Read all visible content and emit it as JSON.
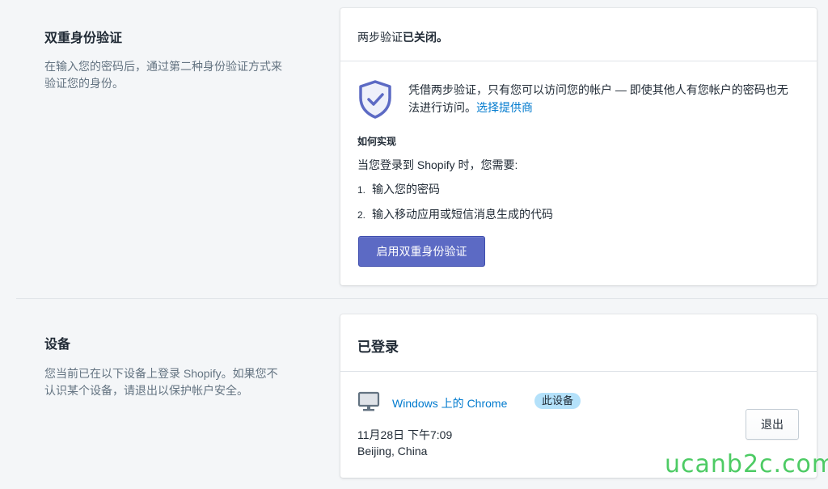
{
  "two_factor": {
    "title": "双重身份验证",
    "description": "在输入您的密码后，通过第二种身份验证方式来验证您的身份。",
    "status_prefix": "两步验证",
    "status_value": "已关闭。",
    "info_text": "凭借两步验证，只有您可以访问您的帐户 — 即使其他人有您帐户的密码也无法进行访问。",
    "info_link": "选择提供商",
    "how_title": "如何实现",
    "how_intro": "当您登录到 Shopify 时，您需要:",
    "steps": [
      {
        "num": "1.",
        "text": "输入您的密码"
      },
      {
        "num": "2.",
        "text": "输入移动应用或短信消息生成的代码"
      }
    ],
    "enable_button": "启用双重身份验证",
    "icon": "shield-check-icon",
    "accent_color": "#5c6ac4"
  },
  "devices": {
    "title": "设备",
    "description": "您当前已在以下设备上登录 Shopify。如果您不认识某个设备，请退出以保护帐户安全。",
    "card_title": "已登录",
    "device_name": "Windows 上的 Chrome",
    "this_device_badge": "此设备",
    "date": "11月28日 下午7:09",
    "location": "Beijing, China",
    "logout_button": "退出",
    "icon": "monitor-icon",
    "link_color": "#007ace"
  },
  "watermark": "ucanb2c.com"
}
